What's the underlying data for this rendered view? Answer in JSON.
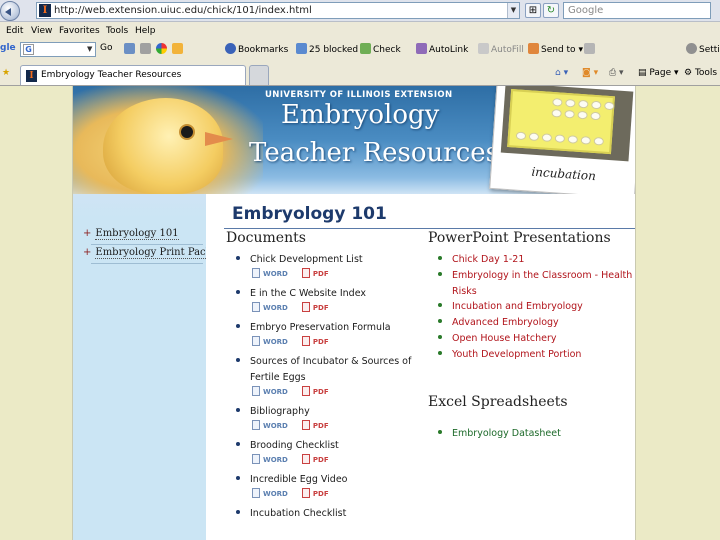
{
  "browser": {
    "url": "http://web.extension.uiuc.edu/chick/101/index.html",
    "search_placeholder": "Google",
    "menu": [
      "Edit",
      "View",
      "Favorites",
      "Tools",
      "Help"
    ],
    "toolbar": {
      "google_label": "G",
      "go_label": "Go",
      "bookmarks": "Bookmarks",
      "blocked": "25 blocked",
      "check": "Check",
      "autolink": "AutoLink",
      "autofill": "AutoFill",
      "sendto": "Send to",
      "settings": "Settings"
    },
    "tab_title": "Embryology Teacher Resources",
    "cmd_bar": {
      "page": "Page",
      "tools": "Tools"
    }
  },
  "site": {
    "university": "UNIVERSITY OF ILLINOIS EXTENSION",
    "title_line1": "Embryology",
    "title_line2": "Teacher Resources",
    "photo_caption": "incubation",
    "sidebar": [
      "Embryology 101",
      "Embryology Print Packet"
    ],
    "page_title": "Embryology 101",
    "documents_heading": "Documents",
    "word_label": "WORD",
    "pdf_label": "PDF",
    "documents": [
      "Chick Development List",
      "E in the C Website Index",
      "Embryo Preservation Formula",
      "Sources of Incubator & Sources of Fertile Eggs",
      "Bibliography",
      "Brooding Checklist",
      "Incredible Egg Video",
      "Incubation Checklist"
    ],
    "ppt_heading": "PowerPoint Presentations",
    "ppt": [
      "Chick Day 1-21",
      "Embryology in the Classroom - Health Risks",
      "Incubation and Embryology",
      "Advanced Embryology",
      "Open House Hatchery",
      "Youth Development Portion"
    ],
    "excel_heading": "Excel Spreadsheets",
    "excel": [
      "Embryology Datasheet"
    ]
  }
}
